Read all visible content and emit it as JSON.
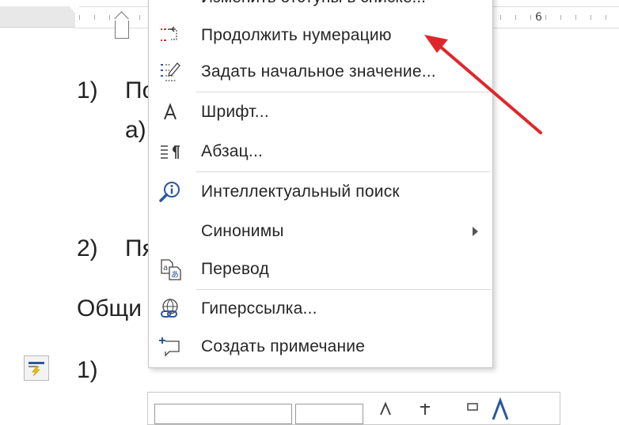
{
  "ruler": {
    "number": "6"
  },
  "document": {
    "lines": [
      {
        "marker": "1)",
        "text": "По"
      },
      {
        "marker": "а)",
        "text": ""
      },
      {
        "marker": "2)",
        "text": "Пя"
      },
      {
        "marker": "",
        "text": "Общи"
      },
      {
        "marker": "1)",
        "text": ""
      }
    ]
  },
  "context_menu": {
    "clipped_top_label": "Изменить отступы в списке...",
    "items": [
      {
        "label": "Продолжить нумерацию",
        "icon": "continue-numbering-icon"
      },
      {
        "label": "Задать начальное значение...",
        "icon": "set-numbering-value-icon"
      },
      {
        "label": "Шрифт...",
        "icon": "font-icon"
      },
      {
        "label": "Абзац...",
        "icon": "paragraph-icon"
      },
      {
        "label": "Интеллектуальный поиск",
        "icon": "smart-lookup-icon"
      },
      {
        "label": "Синонимы",
        "icon": "",
        "has_submenu": true
      },
      {
        "label": "Перевод",
        "icon": "translate-icon"
      },
      {
        "label": "Гиперссылка...",
        "icon": "hyperlink-icon"
      },
      {
        "label": "Создать примечание",
        "icon": "new-comment-icon"
      }
    ]
  },
  "colors": {
    "arrow": "#e0262b",
    "icon_red": "#d13438",
    "icon_blue": "#2b579a"
  }
}
